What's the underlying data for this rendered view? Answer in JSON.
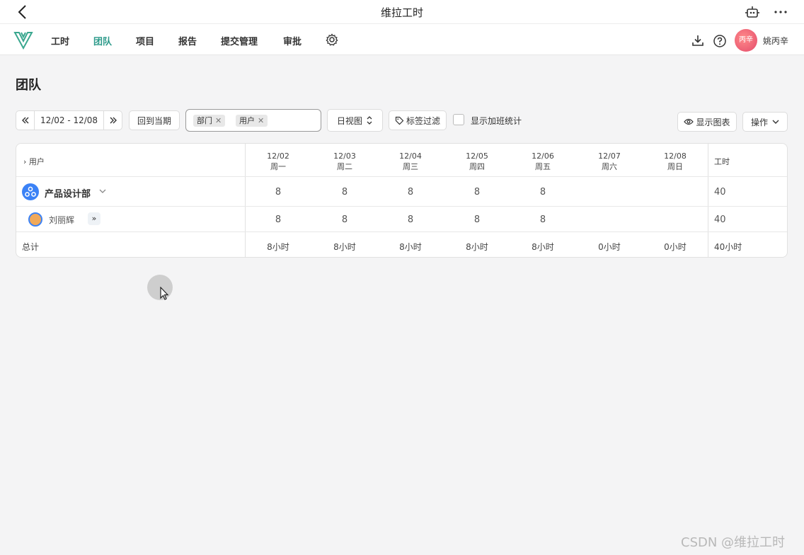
{
  "window": {
    "title": "维拉工时",
    "icons": [
      "back-icon",
      "robot-icon",
      "more-icon"
    ]
  },
  "nav": {
    "items": [
      {
        "label": "工时",
        "active": false
      },
      {
        "label": "团队",
        "active": true
      },
      {
        "label": "项目",
        "active": false
      },
      {
        "label": "报告",
        "active": false
      },
      {
        "label": "提交管理",
        "active": false
      },
      {
        "label": "审批",
        "active": false
      }
    ],
    "avatar_text": "丙辛",
    "username": "姚丙辛",
    "accent_color": "#2c9a8a"
  },
  "page": {
    "title": "团队"
  },
  "toolbar": {
    "date_range": "12/02 - 12/08",
    "today_label": "回到当期",
    "filter_tags": [
      "部门",
      "用户"
    ],
    "view_label": "日视图",
    "tag_filter_label": "标签过滤",
    "overtime_label": "显示加班统计",
    "overtime_checked": false,
    "show_chart_label": "显示图表",
    "ops_label": "操作"
  },
  "table": {
    "user_header": "用户",
    "hours_header": "工时",
    "days": [
      {
        "date": "12/02",
        "weekday": "周一"
      },
      {
        "date": "12/03",
        "weekday": "周二"
      },
      {
        "date": "12/04",
        "weekday": "周三"
      },
      {
        "date": "12/05",
        "weekday": "周四"
      },
      {
        "date": "12/06",
        "weekday": "周五"
      },
      {
        "date": "12/07",
        "weekday": "周六"
      },
      {
        "date": "12/08",
        "weekday": "周日"
      }
    ],
    "rows": [
      {
        "name": "产品设计部",
        "type": "department",
        "values": [
          "8",
          "8",
          "8",
          "8",
          "8",
          "",
          ""
        ],
        "total": "40"
      },
      {
        "name": "刘丽辉",
        "type": "user",
        "values": [
          "8",
          "8",
          "8",
          "8",
          "8",
          "",
          ""
        ],
        "total": "40"
      }
    ],
    "totals": {
      "label": "总计",
      "values": [
        "8小时",
        "8小时",
        "8小时",
        "8小时",
        "8小时",
        "0小时",
        "0小时"
      ],
      "total": "40小时"
    }
  },
  "watermark": "CSDN @维拉工时"
}
